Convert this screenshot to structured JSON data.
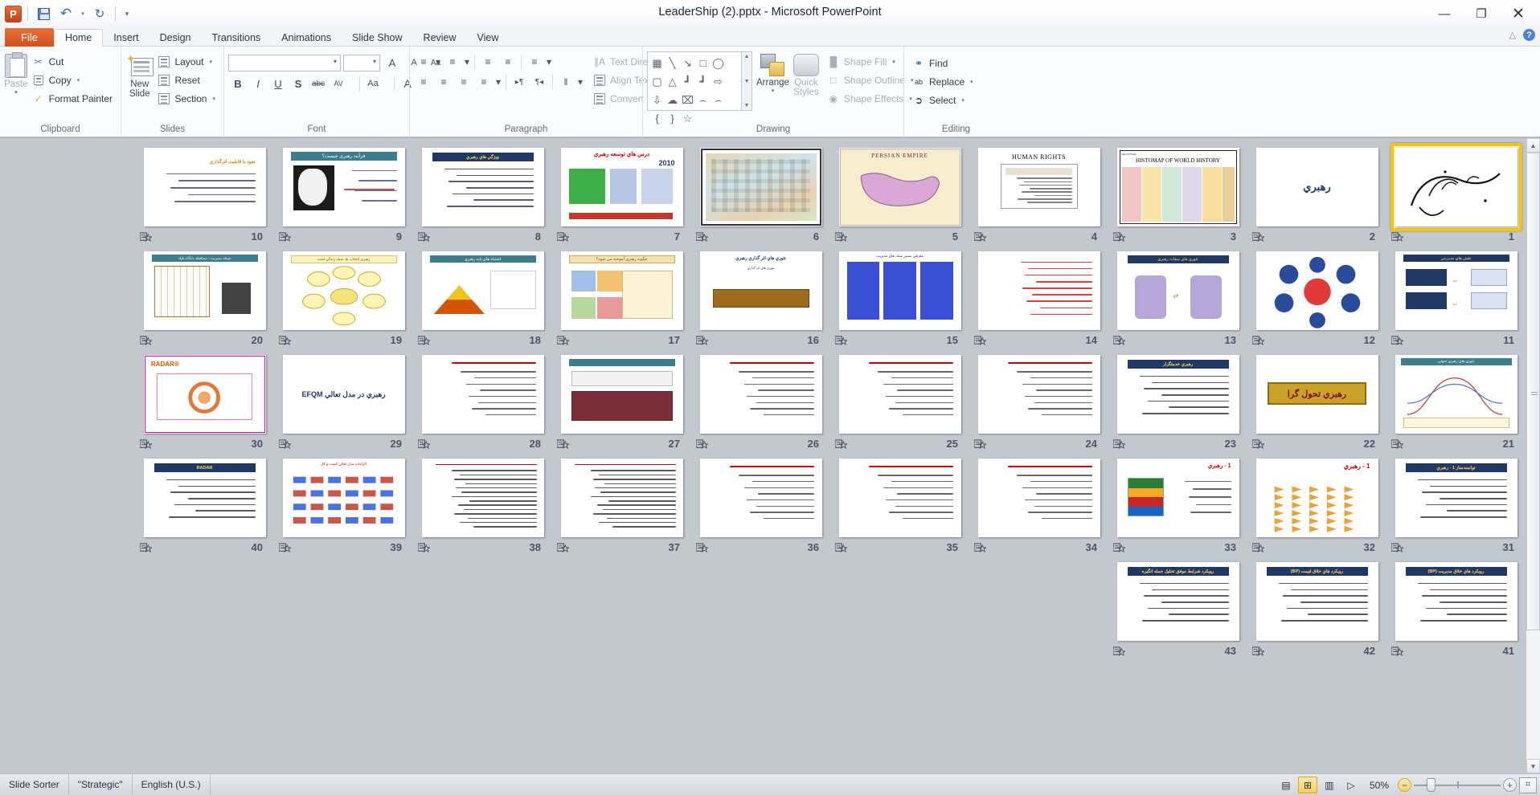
{
  "window": {
    "title": "LeaderShip (2).pptx  -  Microsoft PowerPoint",
    "minimize": "—",
    "restore": "❐",
    "close": "✕"
  },
  "qat": {
    "app_icon": "powerpoint-logo",
    "save": "save-icon",
    "undo": "↶",
    "undo_caret": "▾",
    "redo": "↻",
    "customize": "▾"
  },
  "ribbon": {
    "minimize_label": "△",
    "help_label": "?",
    "tabs": [
      {
        "label": "File",
        "type": "file"
      },
      {
        "label": "Home",
        "type": "active"
      },
      {
        "label": "Insert",
        "type": "normal"
      },
      {
        "label": "Design",
        "type": "normal"
      },
      {
        "label": "Transitions",
        "type": "normal"
      },
      {
        "label": "Animations",
        "type": "normal"
      },
      {
        "label": "Slide Show",
        "type": "normal"
      },
      {
        "label": "Review",
        "type": "normal"
      },
      {
        "label": "View",
        "type": "normal"
      }
    ],
    "groups": {
      "clipboard": {
        "label": "Clipboard",
        "paste": "Paste",
        "paste_caret": "▾",
        "cut": "Cut",
        "copy": "Copy",
        "copy_caret": "▾",
        "format_painter": "Format Painter",
        "dialog_launcher": "⬌"
      },
      "slides": {
        "label": "Slides",
        "new_slide_l1": "New",
        "new_slide_l2": "Slide",
        "new_slide_caret": "▾",
        "layout": "Layout",
        "reset": "Reset",
        "section": "Section",
        "caret": "▾"
      },
      "font": {
        "label": "Font",
        "font_name_value": "",
        "font_size_value": "",
        "grow": "A",
        "shrink": "A",
        "clear_formatting": "Aa",
        "bold": "B",
        "italic": "I",
        "underline": "U",
        "shadow": "S",
        "strikethrough": "abc",
        "char_spacing": "AV",
        "change_case": "Aa",
        "font_color": "A",
        "dialog_launcher": "⬌"
      },
      "paragraph": {
        "label": "Paragraph",
        "bullets": "≡",
        "numbering": "≡",
        "decrease_indent": "≡",
        "increase_indent": "≡",
        "line_spacing": "≡",
        "align_left": "≡",
        "center": "≡",
        "align_right": "≡",
        "justify": "≡",
        "ltr": "▸¶",
        "rtl": "¶◂",
        "columns": "‖",
        "text_direction": "Text Direction",
        "align_text": "Align Text",
        "convert_smartart": "Convert to SmartArt",
        "caret": "▾",
        "dialog_launcher": "⬌"
      },
      "drawing": {
        "label": "Drawing",
        "arrange": "Arrange",
        "quick_styles_l1": "Quick",
        "quick_styles_l2": "Styles",
        "shape_fill": "Shape Fill",
        "shape_outline": "Shape Outline",
        "shape_effects": "Shape Effects",
        "caret": "▾",
        "dialog_launcher": "⬌",
        "shapes": [
          "▭",
          "╲",
          "↘",
          "□",
          "◯",
          "▢",
          "△",
          "┗",
          "┗",
          "⇨",
          "⇩",
          "☁",
          "⌇",
          "⌒",
          "⌢",
          "{",
          "}",
          "☆"
        ]
      },
      "editing": {
        "label": "Editing",
        "find": "Find",
        "replace": "Replace",
        "select": "Select",
        "caret": "▾"
      }
    }
  },
  "status": {
    "view_name": "Slide Sorter",
    "theme_name": "\"Strategic\"",
    "language": "English (U.S.)",
    "zoom_level": "50%",
    "zoom_minus": "−",
    "zoom_plus": "+",
    "fit_to_window": "⌗",
    "views": [
      {
        "name": "normal-view-button",
        "glyph": "▤",
        "active": false
      },
      {
        "name": "slide-sorter-view-button",
        "glyph": "⊞",
        "active": true
      },
      {
        "name": "reading-view-button",
        "glyph": "▥",
        "active": false
      },
      {
        "name": "slide-show-button",
        "glyph": "▷",
        "active": false
      }
    ]
  },
  "sorter": {
    "selected_slide": 1,
    "scroll_up": "▲",
    "scroll_down": "▼",
    "transition_icon": "transition-star-icon",
    "rows": [
      {
        "slides": [
          {
            "n": "1",
            "kind": "calligraphy",
            "title": ""
          },
          {
            "n": "2",
            "kind": "bigword",
            "title": "رهبري"
          },
          {
            "n": "3",
            "kind": "histomap",
            "title": "HISTOMAP OF WORLD HISTORY"
          },
          {
            "n": "4",
            "kind": "humanrights",
            "title": "HUMAN RIGHTS"
          },
          {
            "n": "5",
            "kind": "persianmap",
            "title": "PERSIAN EMPIRE"
          },
          {
            "n": "6",
            "kind": "oldmap",
            "title": ""
          },
          {
            "n": "7",
            "kind": "diagram2010",
            "title": "2010"
          },
          {
            "n": "8",
            "kind": "navylist",
            "title": "ويژگي هاي رهبري"
          },
          {
            "n": "9",
            "kind": "photoslide",
            "title": "فرآيند رهبري چيست؟"
          },
          {
            "n": "10",
            "kind": "goldtext",
            "title": "نفوذ يا قابليت اثرگذاري"
          }
        ]
      },
      {
        "slides": [
          {
            "n": "11",
            "kind": "bluearrows",
            "title": "نقش هاي مديريتي"
          },
          {
            "n": "12",
            "kind": "circlenet",
            "title": ""
          },
          {
            "n": "13",
            "kind": "twofigures",
            "title": "تئوري هاي سفات رهبري"
          },
          {
            "n": "14",
            "kind": "redlines",
            "title": ""
          },
          {
            "n": "15",
            "kind": "bluepanels",
            "title": ""
          },
          {
            "n": "16",
            "kind": "brownbox",
            "title": "تئوري هاي اثر گذاري رهبري"
          },
          {
            "n": "17",
            "kind": "puzzle",
            "title": "چگونه رهبري آموخته مي شود؟"
          },
          {
            "n": "18",
            "kind": "pyramid",
            "title": "اشتباه هاي پايه رهبري"
          },
          {
            "n": "19",
            "kind": "yellowflower",
            "title": "رهبري انتخاب يك سبك زندگي است"
          },
          {
            "n": "20",
            "kind": "grid",
            "title": "شبكه مديريت - محافظه دانگاه بليك"
          }
        ]
      },
      {
        "slides": [
          {
            "n": "21",
            "kind": "curvechart",
            "title": "تئوري هاي رهبري تحولي"
          },
          {
            "n": "22",
            "kind": "goldbanner",
            "title": "رهبري تحول گرا"
          },
          {
            "n": "23",
            "kind": "navylist",
            "title": "رهبري خدمتگزار"
          },
          {
            "n": "24",
            "kind": "redtext",
            "title": ""
          },
          {
            "n": "25",
            "kind": "redtext",
            "title": ""
          },
          {
            "n": "26",
            "kind": "redtext",
            "title": ""
          },
          {
            "n": "27",
            "kind": "maroonbox",
            "title": ""
          },
          {
            "n": "28",
            "kind": "redtext",
            "title": ""
          },
          {
            "n": "29",
            "kind": "bigword",
            "title": "رهبري در مدل تعالي EFQM"
          },
          {
            "n": "30",
            "kind": "radar",
            "title": "RADAR"
          }
        ]
      },
      {
        "slides": [
          {
            "n": "31",
            "kind": "navylist",
            "title": "توانمندساز 1 - رهبري"
          },
          {
            "n": "32",
            "kind": "orangearrows",
            "title": "1 - رهبري"
          },
          {
            "n": "33",
            "kind": "chartslide",
            "title": "1 - رهبري"
          },
          {
            "n": "34",
            "kind": "redtext",
            "title": ""
          },
          {
            "n": "35",
            "kind": "redtext",
            "title": ""
          },
          {
            "n": "36",
            "kind": "redtext",
            "title": ""
          },
          {
            "n": "37",
            "kind": "denseblack",
            "title": ""
          },
          {
            "n": "38",
            "kind": "denseblack",
            "title": ""
          },
          {
            "n": "39",
            "kind": "bluediagram",
            "title": "الزامات مدل تعالي كسب و كار"
          },
          {
            "n": "40",
            "kind": "navylist",
            "title": "RADAR"
          }
        ]
      },
      {
        "slides": [
          {
            "n": "41",
            "kind": "navylist",
            "title": "رويكرد هاي خلاق مديريت (BP)"
          },
          {
            "n": "42",
            "kind": "navylist",
            "title": "رويكرد هاي خلاق قيمت (BP)"
          },
          {
            "n": "43",
            "kind": "navylist",
            "title": "رويكرد شرايط موفق تحليل جمله انگيزه"
          }
        ]
      }
    ]
  },
  "colors": {
    "accent_orange": "#d1521d",
    "selection_gold": "#f0c419",
    "sorter_bg": "#c3c7ce",
    "navy": "#1f3864",
    "teal": "#3d7d8c"
  }
}
